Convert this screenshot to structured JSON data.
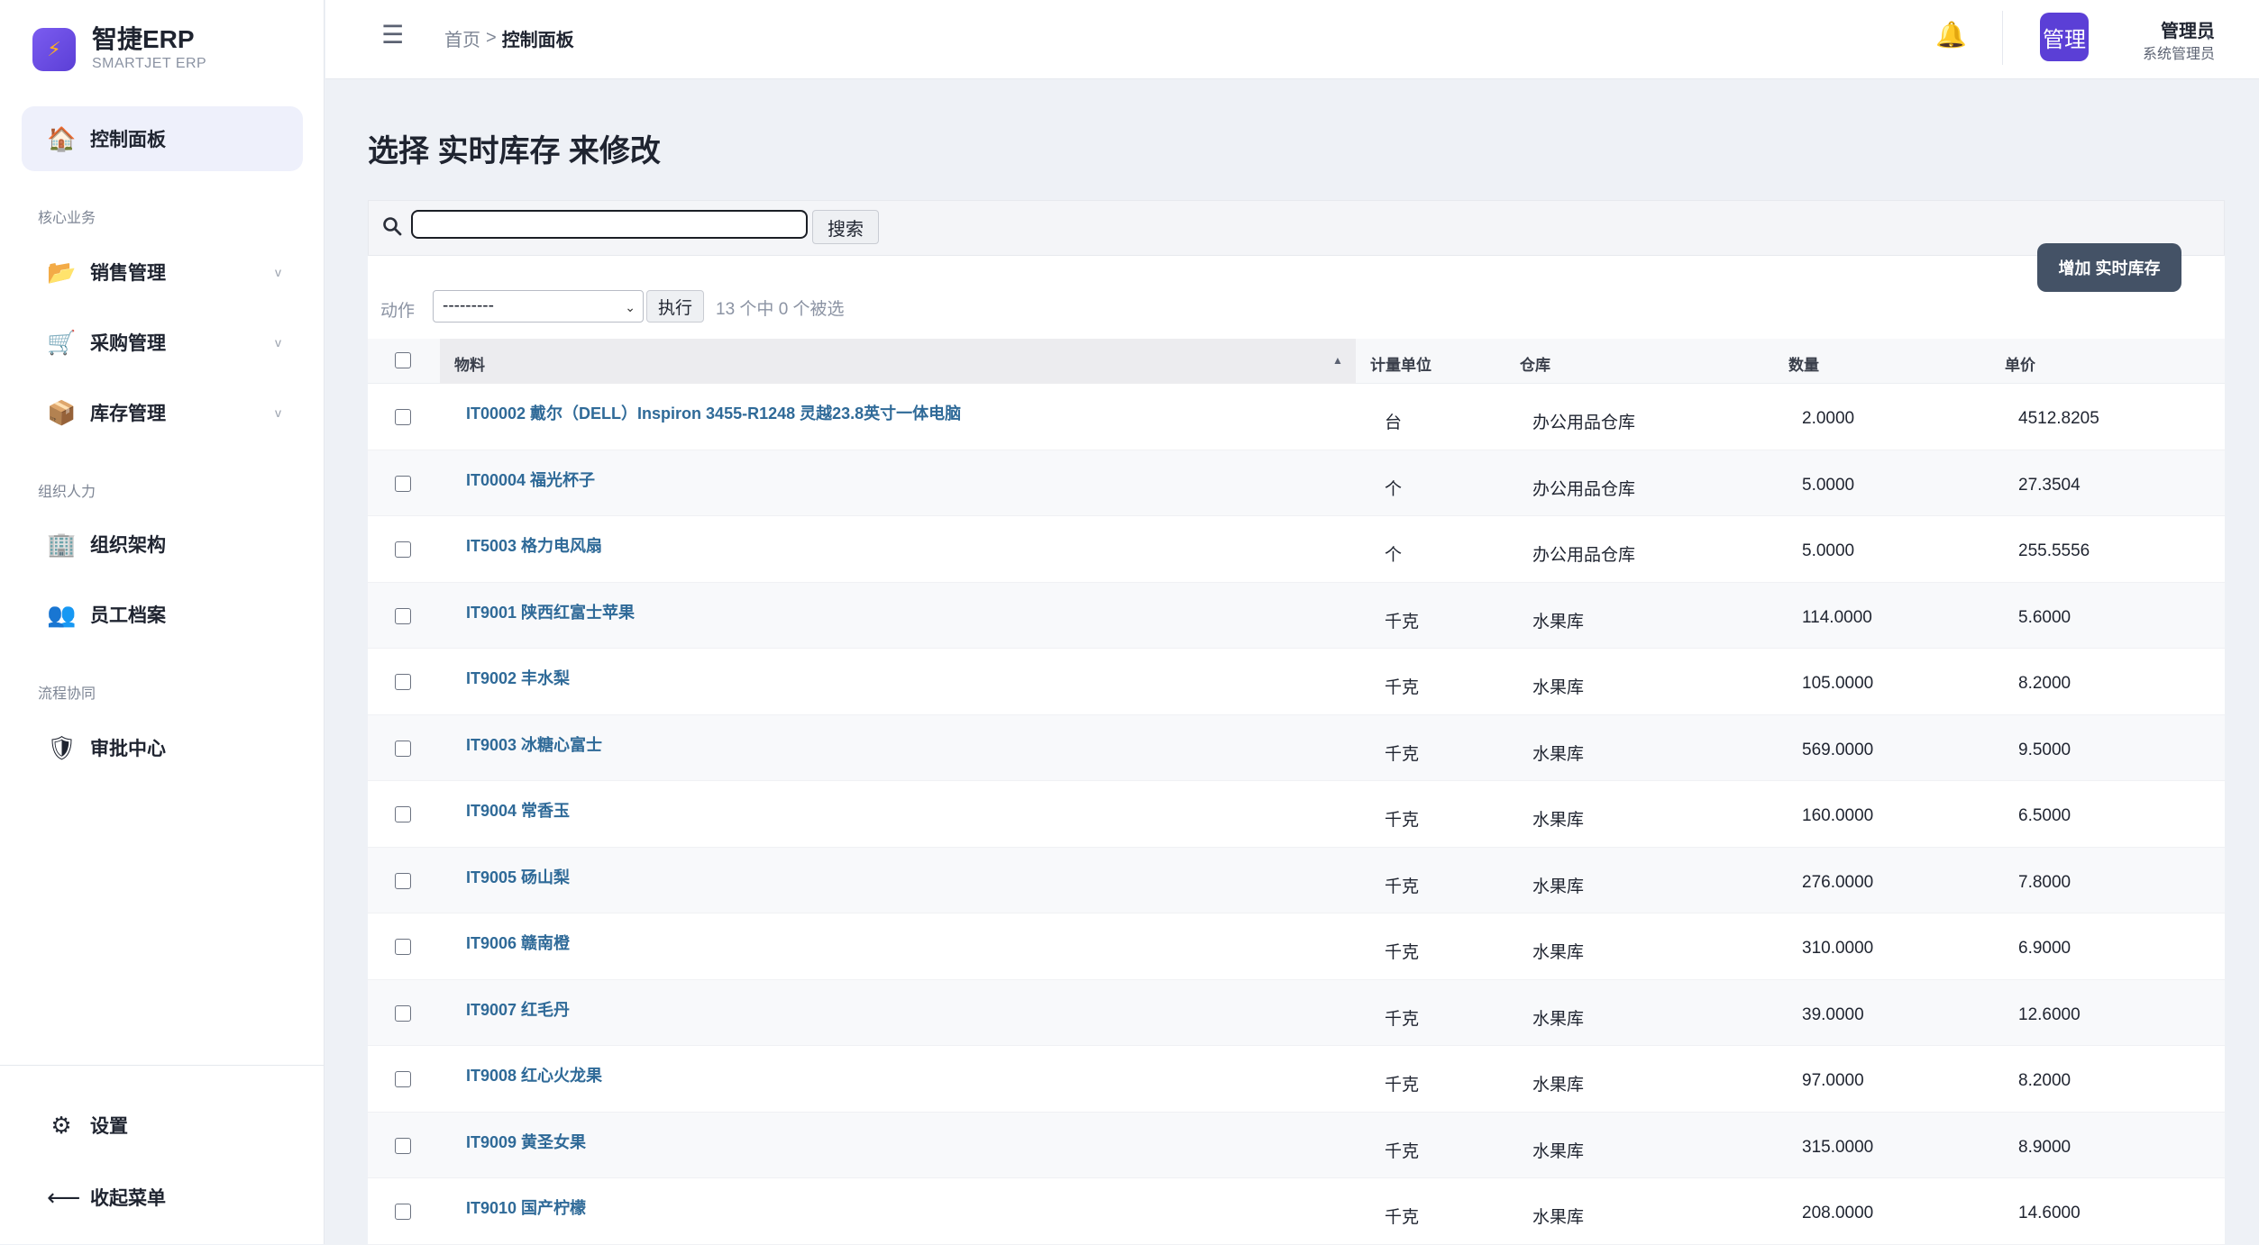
{
  "brand": {
    "title": "智捷ERP",
    "subtitle": "SMARTJET ERP"
  },
  "sidebar": {
    "active": {
      "label": "控制面板",
      "icon": "house-icon"
    },
    "sections": [
      {
        "title": "核心业务",
        "items": [
          {
            "label": "销售管理",
            "icon": "folder-icon",
            "expandable": true
          },
          {
            "label": "采购管理",
            "icon": "cart-icon",
            "expandable": true
          },
          {
            "label": "库存管理",
            "icon": "package-icon",
            "expandable": true
          }
        ]
      },
      {
        "title": "组织人力",
        "items": [
          {
            "label": "组织架构",
            "icon": "building-icon"
          },
          {
            "label": "员工档案",
            "icon": "people-icon"
          }
        ]
      },
      {
        "title": "流程协同",
        "items": [
          {
            "label": "审批中心",
            "icon": "shield-icon"
          }
        ]
      }
    ],
    "bottom": [
      {
        "label": "设置",
        "icon": "gear-icon"
      },
      {
        "label": "收起菜单",
        "icon": "arrow-left-icon"
      }
    ]
  },
  "header": {
    "breadcrumb": {
      "home": "首页",
      "separator": ">",
      "current": "控制面板"
    },
    "user": {
      "avatar": "管理",
      "name": "管理员",
      "role": "系统管理员"
    }
  },
  "page": {
    "title": "选择 实时库存 来修改"
  },
  "search": {
    "value": "",
    "placeholder": "",
    "button": "搜索"
  },
  "add_button": "增加 实时库存",
  "actions": {
    "label": "动作",
    "selected": "---------",
    "run": "执行",
    "count_text": "13 个中 0 个被选"
  },
  "table": {
    "columns": [
      "物料",
      "计量单位",
      "仓库",
      "数量",
      "单价"
    ],
    "rows": [
      {
        "name": "IT00002 戴尔（DELL）Inspiron 3455-R1248 灵越23.8英寸一体电脑",
        "unit": "台",
        "warehouse": "办公用品仓库",
        "qty": "2.0000",
        "price": "4512.8205"
      },
      {
        "name": "IT00004 福光杯子",
        "unit": "个",
        "warehouse": "办公用品仓库",
        "qty": "5.0000",
        "price": "27.3504"
      },
      {
        "name": "IT5003 格力电风扇",
        "unit": "个",
        "warehouse": "办公用品仓库",
        "qty": "5.0000",
        "price": "255.5556"
      },
      {
        "name": "IT9001 陕西红富士苹果",
        "unit": "千克",
        "warehouse": "水果库",
        "qty": "114.0000",
        "price": "5.6000"
      },
      {
        "name": "IT9002 丰水梨",
        "unit": "千克",
        "warehouse": "水果库",
        "qty": "105.0000",
        "price": "8.2000"
      },
      {
        "name": "IT9003 冰糖心富士",
        "unit": "千克",
        "warehouse": "水果库",
        "qty": "569.0000",
        "price": "9.5000"
      },
      {
        "name": "IT9004 常香玉",
        "unit": "千克",
        "warehouse": "水果库",
        "qty": "160.0000",
        "price": "6.5000"
      },
      {
        "name": "IT9005 砀山梨",
        "unit": "千克",
        "warehouse": "水果库",
        "qty": "276.0000",
        "price": "7.8000"
      },
      {
        "name": "IT9006 赣南橙",
        "unit": "千克",
        "warehouse": "水果库",
        "qty": "310.0000",
        "price": "6.9000"
      },
      {
        "name": "IT9007 红毛丹",
        "unit": "千克",
        "warehouse": "水果库",
        "qty": "39.0000",
        "price": "12.6000"
      },
      {
        "name": "IT9008 红心火龙果",
        "unit": "千克",
        "warehouse": "水果库",
        "qty": "97.0000",
        "price": "8.2000"
      },
      {
        "name": "IT9009 黄圣女果",
        "unit": "千克",
        "warehouse": "水果库",
        "qty": "315.0000",
        "price": "8.9000"
      },
      {
        "name": "IT9010 国产柠檬",
        "unit": "千克",
        "warehouse": "水果库",
        "qty": "208.0000",
        "price": "14.6000"
      }
    ]
  }
}
